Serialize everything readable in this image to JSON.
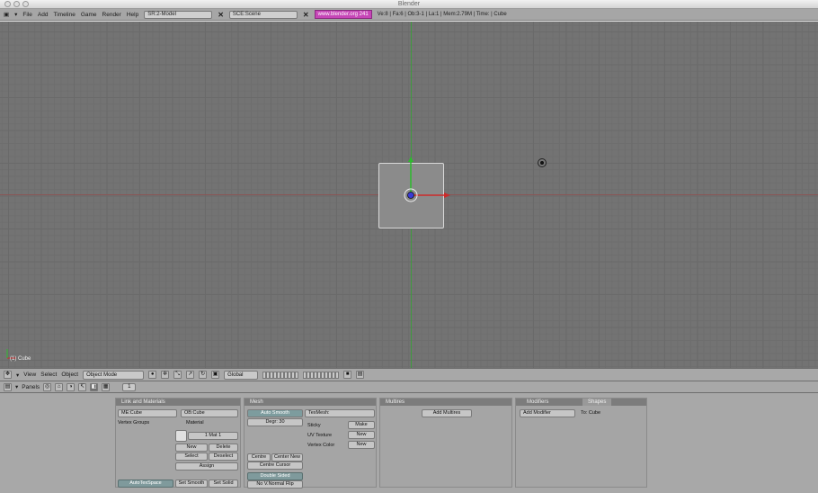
{
  "window": {
    "title": "Blender"
  },
  "menubar": {
    "items": [
      "File",
      "Add",
      "Timeline",
      "Game",
      "Render",
      "Help"
    ],
    "screen": "SR:2-Model",
    "scene": "SCE:Scene",
    "link": "www.blender.org 241",
    "stats": "Ve:8 | Fa:6 | Ob:3-1 | La:1 | Mem:2.79M | Time: | Cube"
  },
  "viewport": {
    "object_label": "(1) Cube"
  },
  "header3d": {
    "items": [
      "View",
      "Select",
      "Object"
    ],
    "mode": "Object Mode",
    "orientation": "Global"
  },
  "buttons_header": {
    "label": "Panels",
    "frame": "1"
  },
  "panels": {
    "link": {
      "title": "Link and Materials",
      "me_field": "ME:Cube",
      "ob_field": "OB:Cube",
      "vertex_groups": "Vertex Groups",
      "material": "Material",
      "mat_index": "1 Mat 1",
      "new": "New",
      "delete": "Delete",
      "select": "Select",
      "deselect": "Deselect",
      "assign": "Assign",
      "autotex": "AutoTexSpace",
      "set_smooth": "Set Smooth",
      "set_solid": "Set Solid"
    },
    "mesh": {
      "title": "Mesh",
      "auto_smooth": "Auto Smooth",
      "degr": "Degr: 30",
      "texmesh": "TexMesh:",
      "sticky": "Sticky",
      "make": "Make",
      "uv_texture": "UV Texture",
      "new1": "New",
      "vertex_color": "Vertex Color",
      "new2": "New",
      "centre": "Centre",
      "centre_new": "Center New",
      "centre_cursor": "Centre Cursor",
      "double_sided": "Double Sided",
      "no_v_normal": "No V.Normal Flip"
    },
    "multires": {
      "title": "Multires",
      "add": "Add Multires"
    },
    "modifiers": {
      "tab1": "Modifiers",
      "tab2": "Shapes",
      "add": "Add Modifier",
      "to": "To: Cube"
    }
  }
}
